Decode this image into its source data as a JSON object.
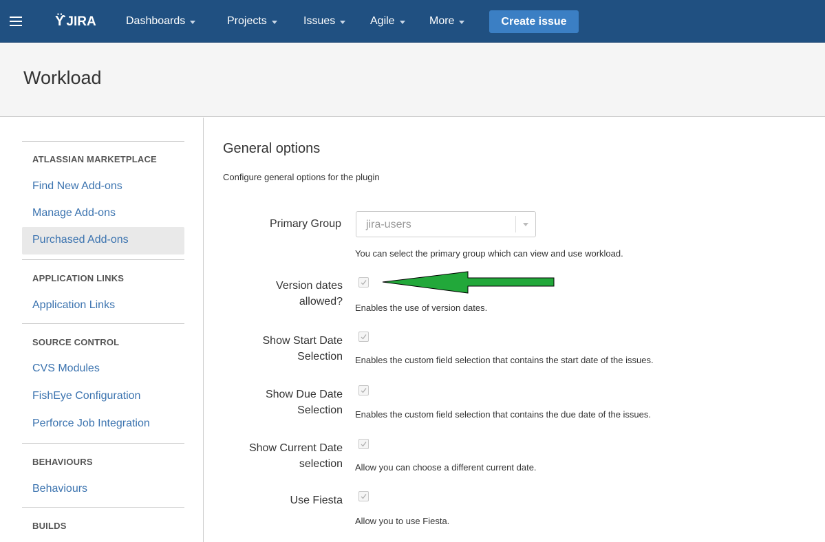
{
  "nav": {
    "logo": "JIRA",
    "items": [
      {
        "label": "Dashboards"
      },
      {
        "label": "Projects"
      },
      {
        "label": "Issues"
      },
      {
        "label": "Agile"
      },
      {
        "label": "More"
      }
    ],
    "create_label": "Create issue"
  },
  "header": {
    "title": "Workload"
  },
  "sidebar": {
    "sections": [
      {
        "title": "ATLASSIAN MARKETPLACE",
        "links": [
          "Find New Add-ons",
          "Manage Add-ons",
          "Purchased Add-ons"
        ]
      },
      {
        "title": "APPLICATION LINKS",
        "links": [
          "Application Links"
        ]
      },
      {
        "title": "SOURCE CONTROL",
        "links": [
          "CVS Modules",
          "FishEye Configuration",
          "Perforce Job Integration"
        ]
      },
      {
        "title": "BEHAVIOURS",
        "links": [
          "Behaviours"
        ]
      },
      {
        "title": "BUILDS",
        "links": []
      }
    ],
    "selected": "Purchased Add-ons"
  },
  "content": {
    "title": "General options",
    "description": "Configure general options for the plugin",
    "primary_group": {
      "label": "Primary Group",
      "value": "jira-users",
      "help": "You can select the primary group which can view and use workload."
    },
    "fields": [
      {
        "label_line1": "Version dates",
        "label_line2": "allowed?",
        "checked": true,
        "help": "Enables the use of version dates."
      },
      {
        "label_line1": "Show Start Date",
        "label_line2": "Selection",
        "checked": true,
        "help": "Enables the custom field selection that contains the start date of the issues."
      },
      {
        "label_line1": "Show Due Date",
        "label_line2": "Selection",
        "checked": true,
        "help": "Enables the custom field selection that contains the due date of the issues."
      },
      {
        "label_line1": "Show Current Date",
        "label_line2": "selection",
        "checked": true,
        "help": "Allow you can choose a different current date."
      },
      {
        "label_line1": "Use Fiesta",
        "label_line2": "",
        "checked": true,
        "help": "Allow you to use Fiesta."
      }
    ]
  },
  "colors": {
    "nav_bg": "#205081",
    "create_btn": "#3b7fc4",
    "link": "#3b73af",
    "arrow_fill": "#22a83a"
  }
}
